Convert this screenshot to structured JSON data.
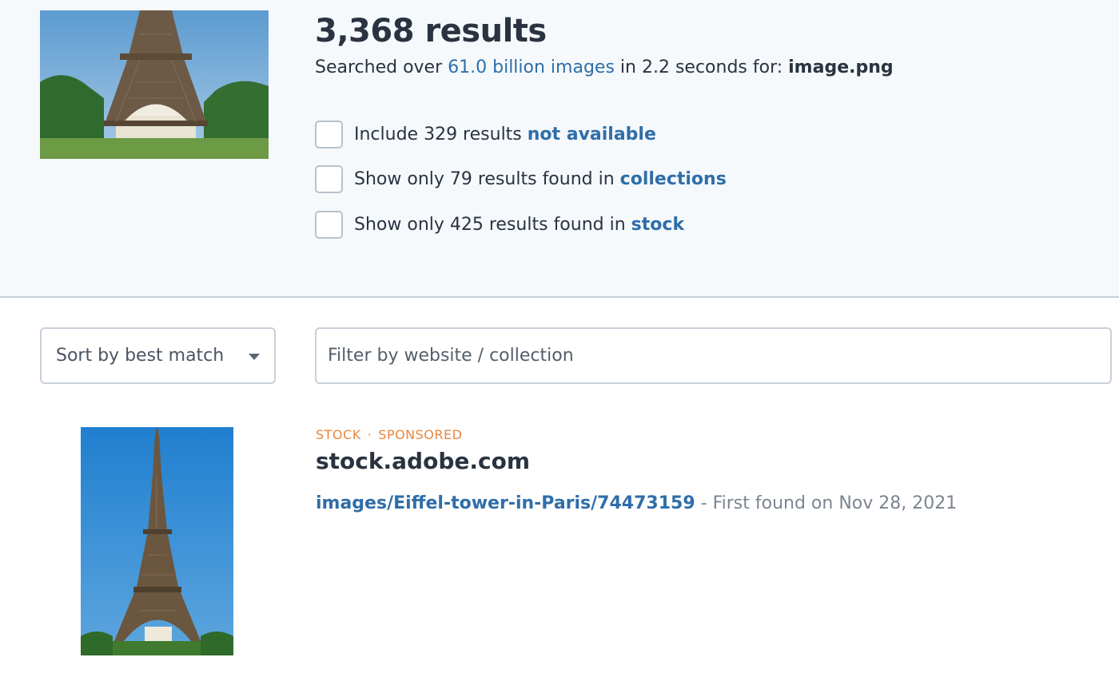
{
  "query_image": {
    "alt": "Eiffel Tower from below with lawn"
  },
  "summary": {
    "count": "3,368 results",
    "searched_prefix": "Searched over ",
    "searched_link": "61.0 billion images",
    "searched_middle": " in 2.2 seconds for: ",
    "filename": "image.png"
  },
  "checks": [
    {
      "prefix": "Include 329 results ",
      "link": "not available"
    },
    {
      "prefix": "Show only 79 results found in ",
      "link": "collections"
    },
    {
      "prefix": "Show only 425 results found in ",
      "link": "stock"
    }
  ],
  "sort": {
    "selected": "Sort by best match"
  },
  "filter": {
    "placeholder": "Filter by website / collection"
  },
  "result": {
    "tag_stock": "STOCK",
    "tag_sep": "·",
    "tag_sponsored": "SPONSORED",
    "domain": "stock.adobe.com",
    "path": "images/Eiffel-tower-in-Paris/74473159",
    "found": " - First found on Nov 28, 2021"
  },
  "icons": {
    "sort_caret": "chevron-down-icon"
  },
  "colors": {
    "link": "#2f6ea8",
    "tag": "#e8853d",
    "panel": "#f5f9fc"
  }
}
